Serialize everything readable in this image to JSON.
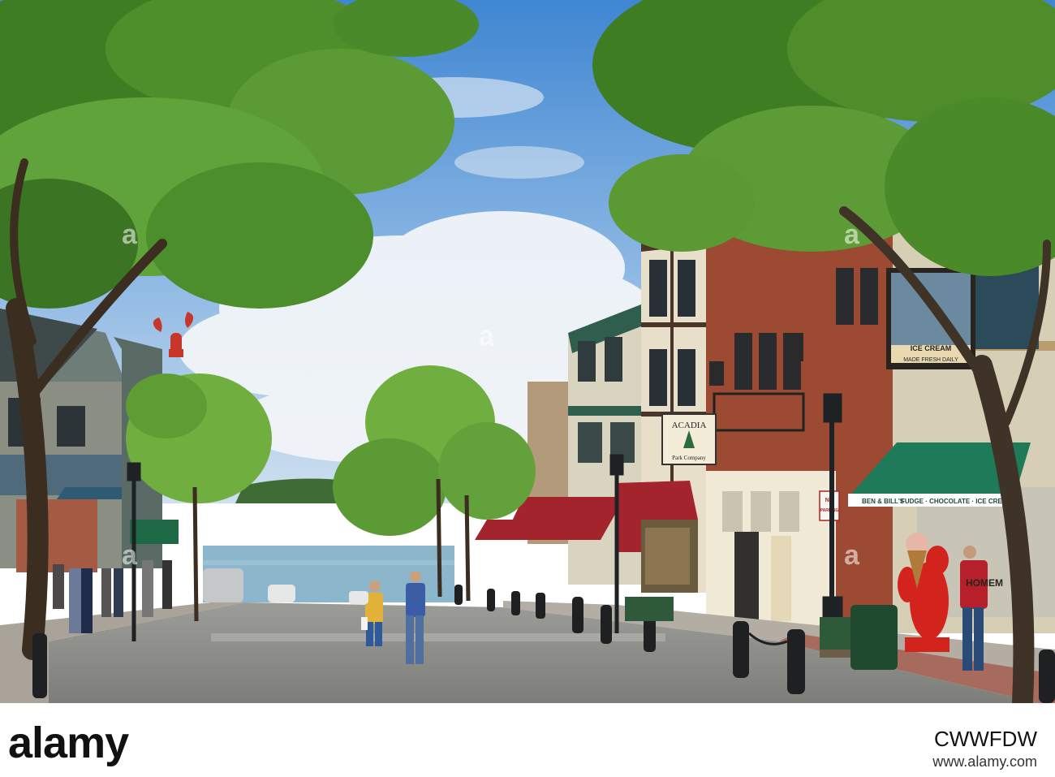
{
  "scene": {
    "signs": {
      "acadia_line1": "ACADIA",
      "acadia_line2": "Park Company",
      "no_parking_line1": "NO",
      "no_parking_line2": "PARKING",
      "ice_cream_vertical": "ICE CREAM",
      "made_fresh": "MADE FRESH DAILY",
      "awning_shop": "BEN & BILL'S",
      "awning_text": "FUDGE · CHOCOLATE · ICE CREAM",
      "homemade": "HOMEM"
    }
  },
  "stock": {
    "logo": "alamy",
    "image_id": "CWWFDW",
    "site": "www.alamy.com"
  },
  "colors": {
    "sky": "#5e9bd6",
    "tree": "#4e8f2c",
    "road": "#8e8f8a",
    "water": "#7fb3cf",
    "awning_red": "#a3242c",
    "awning_green": "#1e7a58",
    "brick": "#9c4a32"
  }
}
